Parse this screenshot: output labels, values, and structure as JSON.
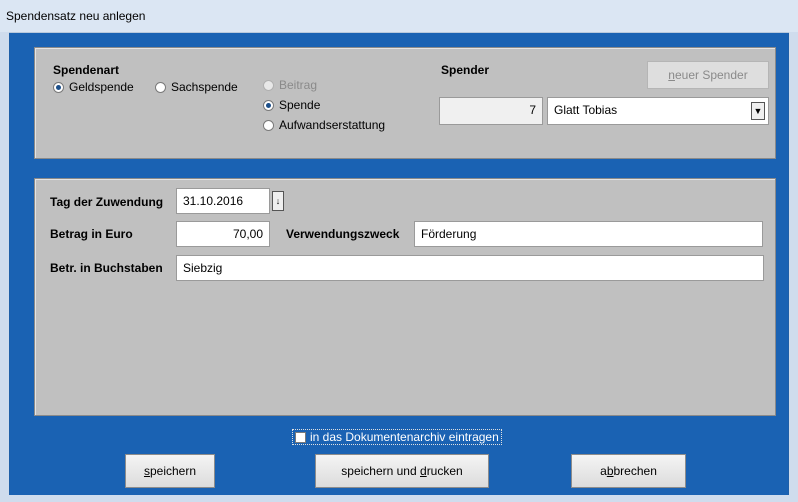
{
  "window": {
    "title": "Spendensatz neu anlegen"
  },
  "spendenart": {
    "heading": "Spendenart",
    "option_geld": "Geldspende",
    "option_sach": "Sachspende",
    "option_beitrag": "Beitrag",
    "option_spende": "Spende",
    "option_aufwand": "Aufwandserstattung",
    "selected_art": "Geldspende",
    "selected_typ": "Spende"
  },
  "spender": {
    "heading": "Spender",
    "new_button_pre": "n",
    "new_button_rest": "euer Spender",
    "id": "7",
    "name": "Glatt Tobias"
  },
  "details": {
    "date_label": "Tag der Zuwendung",
    "date_value": "31.10.2016",
    "amount_label": "Betrag in Euro",
    "amount_value": "70,00",
    "purpose_label": "Verwendungszweck",
    "purpose_value": "Förderung",
    "words_label": "Betr. in Buchstaben",
    "words_value": "Siebzig"
  },
  "archive": {
    "label": "in das Dokumentenarchiv eintragen",
    "checked": false
  },
  "buttons": {
    "save_pre": "s",
    "save_rest": "peichern",
    "save_print_pre": "speichern und ",
    "save_print_ul": "d",
    "save_print_rest": "rucken",
    "cancel_pre": "a",
    "cancel_ul": "b",
    "cancel_rest": "brechen"
  }
}
